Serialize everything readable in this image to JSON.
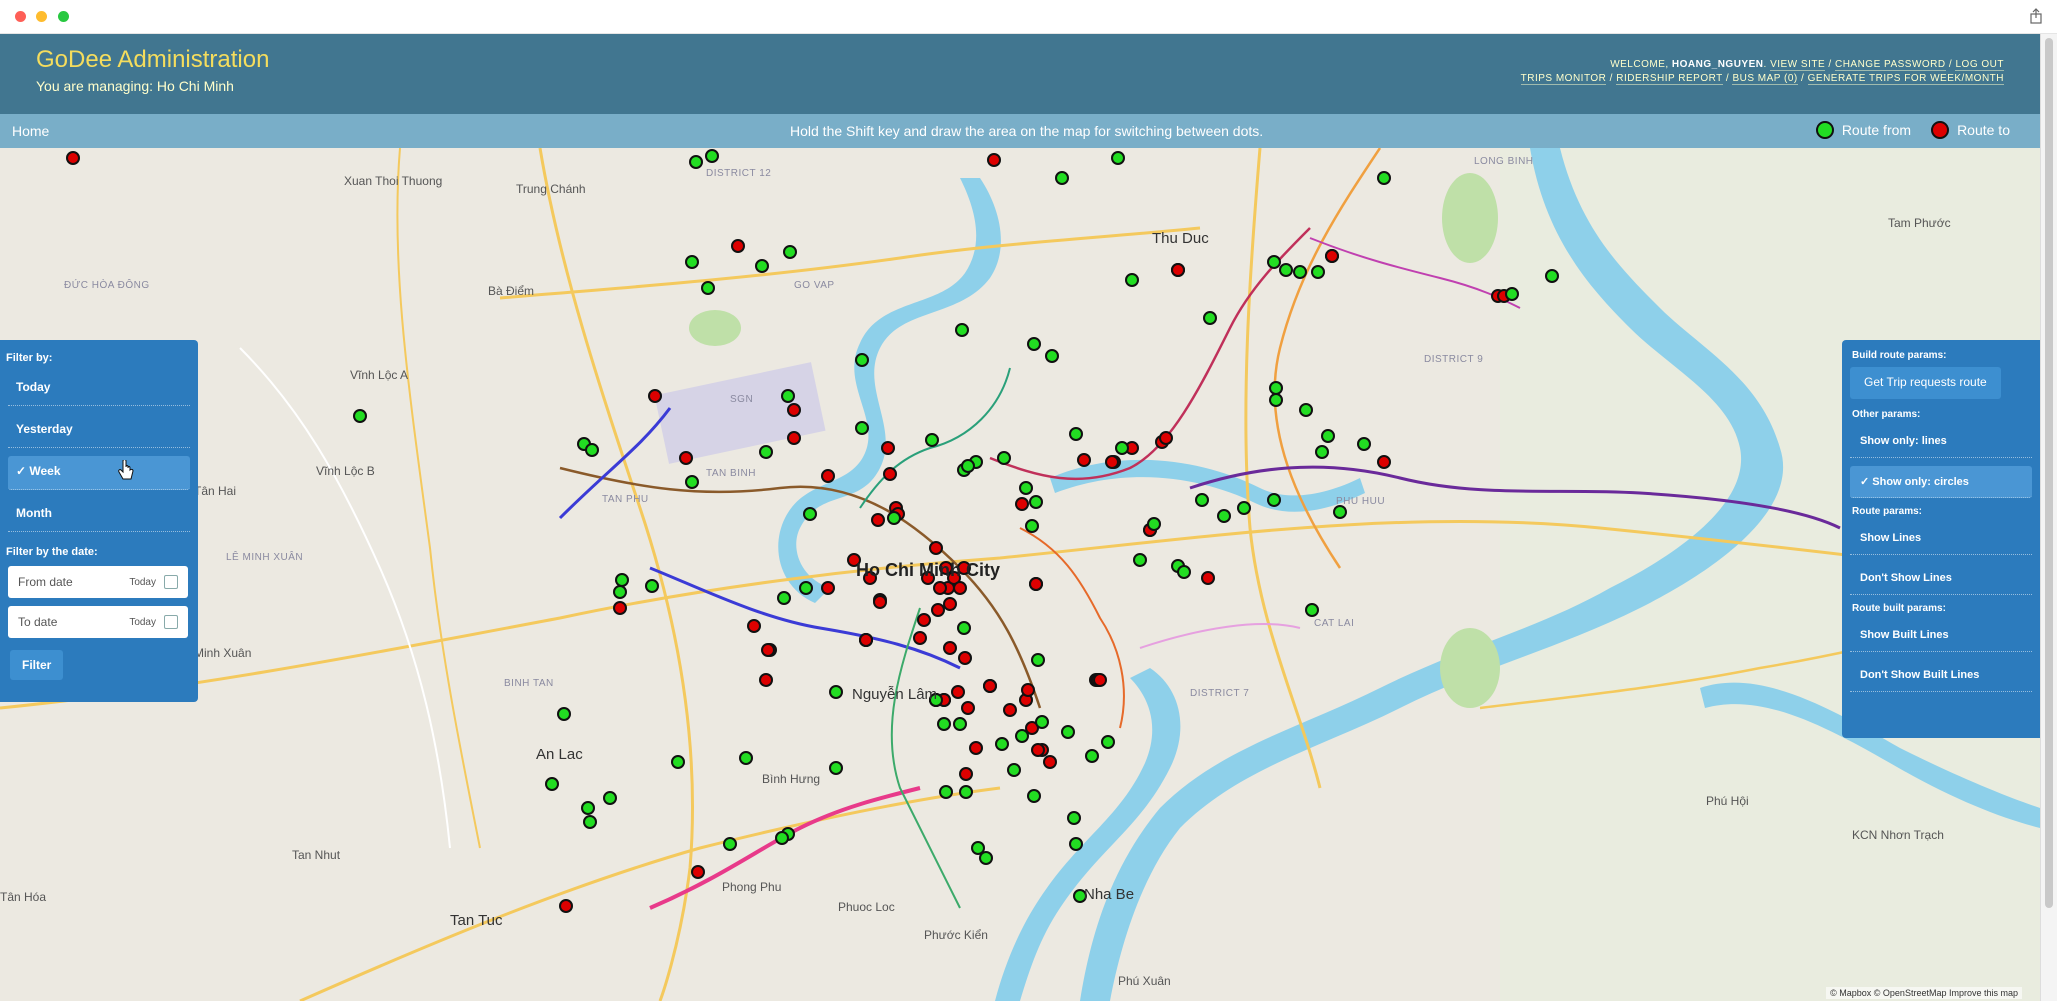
{
  "window": {
    "share_icon": "share-icon"
  },
  "header": {
    "brand": "GoDee Administration",
    "managing": "You are managing: Ho Chi Minh",
    "welcome_prefix": "WELCOME,",
    "username": "HOANG_NGUYEN",
    "links_line1": [
      "VIEW SITE",
      "CHANGE PASSWORD",
      "LOG OUT"
    ],
    "links_line2": [
      "TRIPS MONITOR",
      "RIDERSHIP REPORT",
      "BUS MAP (0)",
      "GENERATE TRIPS FOR WEEK/MONTH"
    ]
  },
  "breadcrumbs": {
    "home": "Home",
    "hint": "Hold the Shift key and draw the area on the map for switching between dots.",
    "legend_from": "Route from",
    "legend_to": "Route to",
    "colors": {
      "from": "#22dd22",
      "to": "#dd0000"
    }
  },
  "filter_panel": {
    "title": "Filter by:",
    "options": [
      {
        "label": "Today",
        "active": false
      },
      {
        "label": "Yesterday",
        "active": false
      },
      {
        "label": "✓ Week",
        "active": true
      },
      {
        "label": "Month",
        "active": false
      }
    ],
    "date_title": "Filter by the date:",
    "from_placeholder": "From date",
    "to_placeholder": "To date",
    "today_label": "Today",
    "filter_button": "Filter"
  },
  "params_panel": {
    "build_title": "Build route params:",
    "get_trip_button": "Get Trip requests route",
    "other_title": "Other params:",
    "show_only_lines": "Show only: lines",
    "show_only_circles": "✓ Show only: circles",
    "route_title": "Route params:",
    "show_lines": "Show Lines",
    "dont_show_lines": "Don't Show Lines",
    "built_title": "Route built params:",
    "show_built_lines": "Show Built Lines",
    "dont_show_built_lines": "Don't Show Built Lines"
  },
  "map": {
    "attribution": "© Mapbox © OpenStreetMap  Improve this map",
    "places": {
      "center": "Ho Chi Minh City",
      "thu_duc": "Thu Duc",
      "xuan_thoi": "Xuan Thoi Thuong",
      "trung_chanh": "Trung Chánh",
      "ba_diem": "Bà Điểm",
      "vinh_loc_a": "Vĩnh Lộc A",
      "vinh_loc_b": "Vĩnh Lộc B",
      "tan_phu": "TAN PHU",
      "tan_binh": "TAN BINH",
      "binh_tan": "BINH TAN",
      "an_lac": "An Lac",
      "tan_tuc": "Tan Tuc",
      "tan_nhut": "Tan Nhut",
      "phong_phu": "Phong Phu",
      "nha_be": "Nha Be",
      "binh_hung": "Bình Hưng",
      "phuoc_loc": "Phuoc Loc",
      "phuoc_kien": "Phước Kiển",
      "phu_xuan": "Phú Xuân",
      "phu_huu": "PHU HUU",
      "cat_lai": "CAT LAI",
      "long_binh": "LONG BINH",
      "tam_phuoc": "Tam Phước",
      "phu_hoi": "Phú Hội",
      "kcn": "KCN Nhơn Trạch",
      "district_7": "DISTRICT 7",
      "district_9": "DISTRICT 9",
      "district_12": "DISTRICT 12",
      "go_vap": "GO VAP",
      "nguyen_lan": "Nguyễn Lâm",
      "sgn": "SGN",
      "duc_hoa_dong": "ĐỨC HÒA ĐÔNG",
      "le_minh_xuan": "LÊ MINH XUÂN",
      "tan_hoa": "Tân Hóa",
      "minh_xuan": "h Minh Xuân",
      "tan_hai": "Tân Hai"
    }
  }
}
